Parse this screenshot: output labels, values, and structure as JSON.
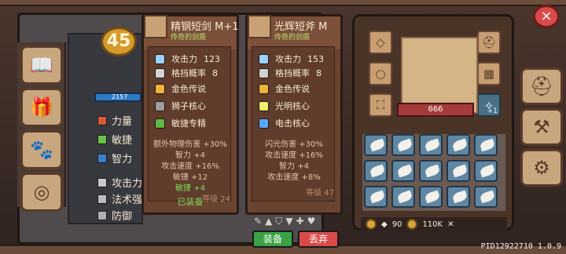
{
  "character": {
    "level": "45",
    "hp_bar_text": "2157",
    "stats": [
      {
        "icon_name": "fist-icon",
        "label": "力量"
      },
      {
        "icon_name": "feather-icon",
        "label": "敏捷"
      },
      {
        "icon_name": "book-icon",
        "label": "智力"
      },
      {
        "icon_name": "sword-icon",
        "label": "攻击力"
      },
      {
        "icon_name": "staff-icon",
        "label": "法术强"
      },
      {
        "icon_name": "shield-icon",
        "label": "防御"
      }
    ]
  },
  "tooltip_left": {
    "title": "精钢短剑 M+1",
    "subtitle": "传奇的剑盾",
    "lines": [
      {
        "icon_name": "sword-icon",
        "label": "攻击力",
        "value": "123"
      },
      {
        "icon_name": "shield-icon",
        "label": "格挡概率",
        "value": "8"
      },
      {
        "icon_name": "fire-icon",
        "label": "金色传说",
        "value": ""
      },
      {
        "icon_name": "lion-icon",
        "label": "狮子核心",
        "value": ""
      },
      {
        "icon_name": "leaf-icon",
        "label": "敏捷专精",
        "value": ""
      }
    ],
    "bonuses": [
      "额外物理伤害 +30%",
      "智力 +4",
      "攻击速度 +16%",
      "敏捷 +12",
      "敏捷 +4"
    ],
    "level_text": "等级 24",
    "equipped_label": "已装备"
  },
  "tooltip_right": {
    "title": "光辉短斧 M",
    "subtitle": "传奇的剑盾",
    "lines": [
      {
        "icon_name": "sword-icon",
        "label": "攻击力",
        "value": "153"
      },
      {
        "icon_name": "shield-icon",
        "label": "格挡概率",
        "value": "8"
      },
      {
        "icon_name": "fire-icon",
        "label": "金色传说",
        "value": ""
      },
      {
        "icon_name": "light-icon",
        "label": "光明核心",
        "value": ""
      },
      {
        "icon_name": "lightning-icon",
        "label": "电击核心",
        "value": ""
      }
    ],
    "bonuses": [
      "闪光伤害 +30%",
      "攻击速度 +16%",
      "智力 +4",
      "攻击速度 +8%"
    ],
    "level_text": "等级 47",
    "buttons": {
      "equip": "装备",
      "discard": "丢弃"
    }
  },
  "equipment": {
    "hp_value": "666",
    "right_slot_badge": "+1",
    "slots_left": [
      "collar-icon",
      "ring-icon",
      "boots-icon"
    ],
    "slots_right": [
      "helmet-icon",
      "armor-icon",
      "axe-icon"
    ],
    "inventory": {
      "rows": 3,
      "cols": 5,
      "items": [
        "boots-icon",
        "wing-icon",
        "wing-icon",
        "wing-icon",
        "wing-icon",
        "wing-icon",
        "wing-icon",
        "wing-icon",
        "metal-icon",
        "metal-icon",
        "armor-icon",
        "axe-icon",
        "",
        "",
        ""
      ]
    },
    "currency": {
      "lock_label": "",
      "gem": "90",
      "coin": "110K"
    }
  },
  "side_buttons": [
    "helmet-icon",
    "tools-icon",
    "gear-icon"
  ],
  "left_buttons": [
    "book-icon",
    "gift-icon",
    "paw-icon",
    "target-icon"
  ],
  "system": {
    "close_label": "×",
    "pid": "PID12922710 1.0.9"
  }
}
